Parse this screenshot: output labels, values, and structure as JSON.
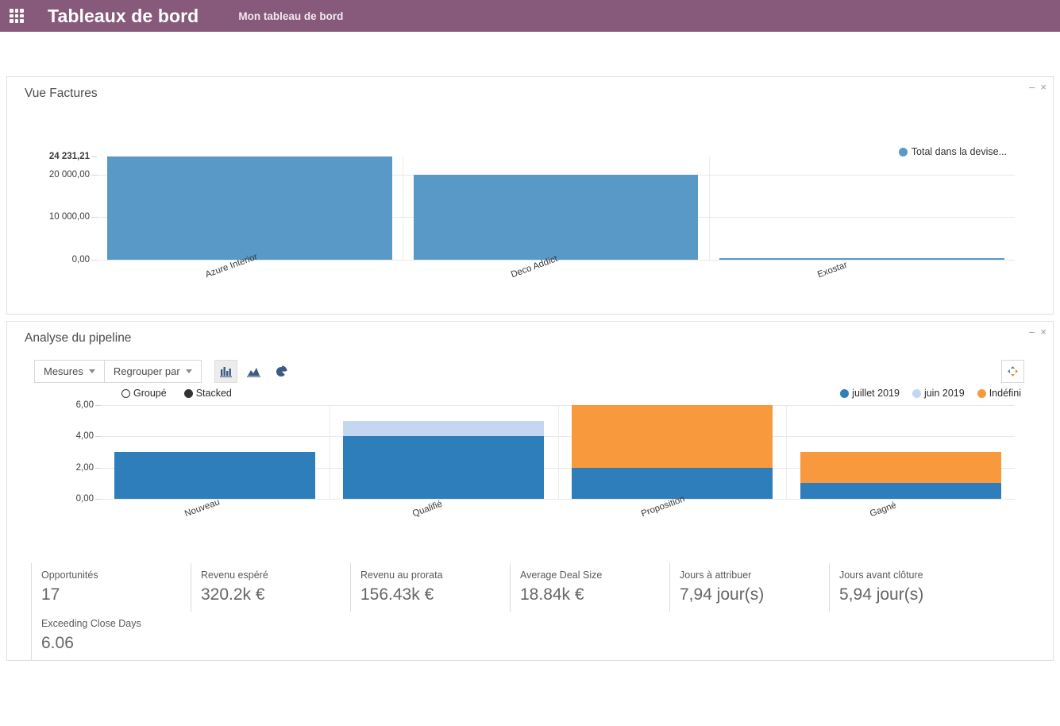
{
  "topbar": {
    "apps_icon": "apps-grid-icon",
    "brand": "Tableaux de bord",
    "board_name": "Mon tableau de bord"
  },
  "panels": [
    {
      "title": "Vue Factures",
      "minimize_label": "–",
      "close_label": "×"
    },
    {
      "title": "Analyse du pipeline",
      "minimize_label": "–",
      "close_label": "×"
    }
  ],
  "pipeline_toolbar": {
    "measures_label": "Mesures",
    "groupby_label": "Regrouper par",
    "chart_types": [
      {
        "name": "bar-chart-icon",
        "active": true
      },
      {
        "name": "area-chart-icon",
        "active": false
      },
      {
        "name": "pie-chart-icon",
        "active": false
      }
    ],
    "expand_icon": "expand-icon"
  },
  "pipeline_modes": [
    {
      "label": "Groupé",
      "selected": false
    },
    {
      "label": "Stacked",
      "selected": true
    }
  ],
  "kpis": [
    {
      "label": "Opportunités",
      "value": "17"
    },
    {
      "label": "Revenu espéré",
      "value": "320.2k €"
    },
    {
      "label": "Revenu au prorata",
      "value": "156.43k €"
    },
    {
      "label": "Average Deal Size",
      "value": "18.84k €"
    },
    {
      "label": "Jours à attribuer",
      "value": "7,94 jour(s)"
    },
    {
      "label": "Jours avant clôture",
      "value": "5,94 jour(s)"
    },
    {
      "label": "Exceeding Close Days",
      "value": "6.06"
    }
  ],
  "colors": {
    "brand_purple": "#875A7B",
    "blue": "#2E7EBB",
    "bar_blue": "#5899c7",
    "light_blue": "#c3d7f0",
    "orange": "#f9993d"
  },
  "chart_data": [
    {
      "type": "bar",
      "title": "Vue Factures",
      "categories": [
        "Azure Interior",
        "Deco Addict",
        "Exostar"
      ],
      "values": [
        24231.21,
        20000.0,
        50.0
      ],
      "series": [
        {
          "name": "Total dans la devise...",
          "values": [
            24231.21,
            20000.0,
            50.0
          ],
          "color": "#5899c7"
        }
      ],
      "legend": [
        "Total dans la devise..."
      ],
      "legend_position": "top-right",
      "ytick_labels": [
        "24 231,21",
        "20 000,00",
        "10 000,00",
        "0,00"
      ],
      "ytick_values": [
        24231.21,
        20000.0,
        10000.0,
        0.0
      ],
      "ylim": [
        0,
        24231.21
      ],
      "xlabel": "",
      "ylabel": "",
      "grid": true
    },
    {
      "type": "bar",
      "title": "Analyse du pipeline",
      "stacked": true,
      "categories": [
        "Nouveau",
        "Qualifié",
        "Proposition",
        "Gagné"
      ],
      "series": [
        {
          "name": "juillet 2019",
          "color": "#2E7EBB",
          "values": [
            3.0,
            4.0,
            2.0,
            1.0
          ]
        },
        {
          "name": "juin 2019",
          "color": "#c3d7f0",
          "values": [
            0.0,
            1.0,
            0.0,
            0.0
          ]
        },
        {
          "name": "Indéfini",
          "color": "#f9993d",
          "values": [
            0.0,
            0.0,
            4.0,
            2.0
          ]
        }
      ],
      "totals": [
        3.0,
        5.0,
        6.0,
        3.0
      ],
      "legend": [
        "juillet 2019",
        "juin 2019",
        "Indéfini"
      ],
      "legend_position": "top-right",
      "ytick_labels": [
        "6,00",
        "4,00",
        "2,00",
        "0,00"
      ],
      "ytick_values": [
        6.0,
        4.0,
        2.0,
        0.0
      ],
      "ylim": [
        0,
        6
      ],
      "xlabel": "",
      "ylabel": "",
      "grid": true
    }
  ]
}
